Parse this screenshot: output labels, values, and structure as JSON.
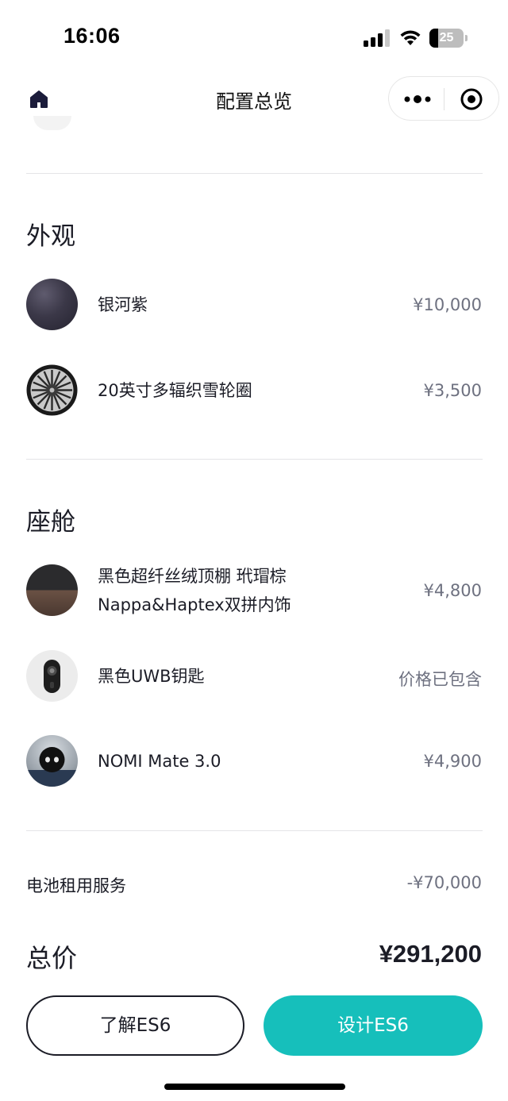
{
  "status_bar": {
    "time": "16:06",
    "battery_level": "25",
    "battery_fraction": 0.25,
    "icons": [
      "signal-icon",
      "wifi-icon",
      "battery-icon"
    ]
  },
  "nav": {
    "title": "配置总览",
    "home_icon": "home-icon",
    "more_icon": "more-icon",
    "close_icon": "target-icon"
  },
  "exterior": {
    "title": "外观",
    "items": [
      {
        "name": "银河紫",
        "price": "¥10,000",
        "thumb": "purple-paint-swatch"
      },
      {
        "name": "20英寸多辐织雪轮圈",
        "price": "¥3,500",
        "thumb": "wheel-image"
      }
    ]
  },
  "cabin": {
    "title": "座舱",
    "items": [
      {
        "name_line1": "黑色超纤丝绒顶棚 玳瑁棕",
        "name_line2": "Nappa&Haptex双拼内饰",
        "price": "¥4,800",
        "thumb": "interior-swatch"
      },
      {
        "name": "黑色UWB钥匙",
        "price": "价格已包含",
        "thumb": "key-image"
      },
      {
        "name": "NOMI Mate 3.0",
        "price": "¥4,900",
        "thumb": "nomi-image"
      }
    ]
  },
  "battery_service": {
    "label": "电池租用服务",
    "value": "-¥70,000"
  },
  "total": {
    "label": "总价",
    "value": "¥291,200"
  },
  "buttons": {
    "learn": "了解ES6",
    "design": "设计ES6"
  },
  "colors": {
    "accent": "#16bfbb",
    "text": "#1b1c26",
    "muted": "#6e7180",
    "divider": "#e4e4e7"
  }
}
